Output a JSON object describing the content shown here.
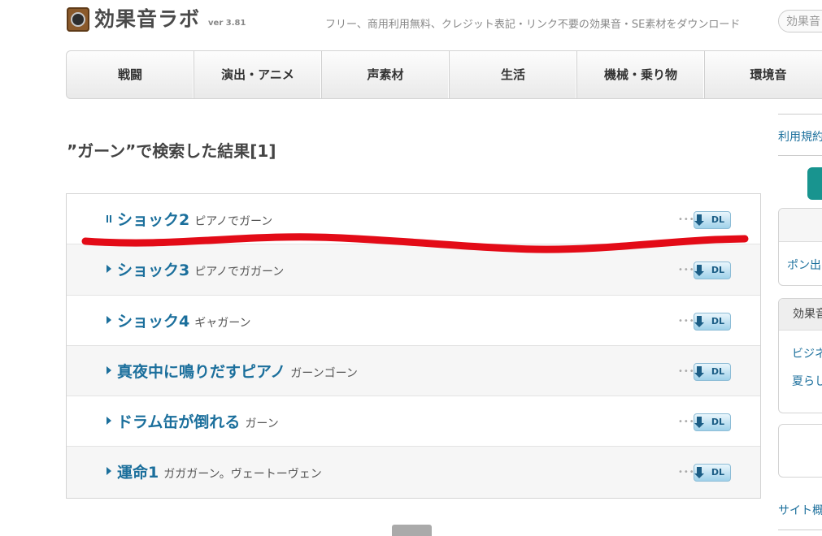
{
  "header": {
    "logo_text": "効果音ラボ",
    "version": "ver 3.81",
    "tagline": "フリー、商用利用無料、クレジット表記・リンク不要の効果音・SE素材をダウンロード",
    "search_placeholder": "効果音"
  },
  "nav": {
    "items": [
      {
        "label": "戦闘"
      },
      {
        "label": "演出・アニメ"
      },
      {
        "label": "声素材"
      },
      {
        "label": "生活"
      },
      {
        "label": "機械・乗り物"
      },
      {
        "label": "環境音"
      }
    ]
  },
  "search_result": {
    "heading": "”ガーン”で検索した結果[1]"
  },
  "results": [
    {
      "title": "ショック2",
      "desc": "ピアノでガーン",
      "dl_label": "DL",
      "playing": true
    },
    {
      "title": "ショック3",
      "desc": "ピアノでガガーン",
      "dl_label": "DL",
      "playing": false
    },
    {
      "title": "ショック4",
      "desc": "ギャガーン",
      "dl_label": "DL",
      "playing": false
    },
    {
      "title": "真夜中に鳴りだすピアノ",
      "desc": "ガーンゴーン",
      "dl_label": "DL",
      "playing": false
    },
    {
      "title": "ドラム缶が倒れる",
      "desc": "ガーン",
      "dl_label": "DL",
      "playing": false
    },
    {
      "title": "運命1",
      "desc": "ガガガーン。ヴェートーヴェン",
      "dl_label": "DL",
      "playing": false
    }
  ],
  "sidebar": {
    "terms_link": "利用規約",
    "pon_link": "ポン出",
    "panel_head": "効果音",
    "panel_links": [
      "ビジネ",
      "夏らし"
    ],
    "sitemap_link": "サイト概"
  },
  "colors": {
    "link": "#1b6f9c",
    "annotation": "#e30b17",
    "teal": "#18948f"
  }
}
